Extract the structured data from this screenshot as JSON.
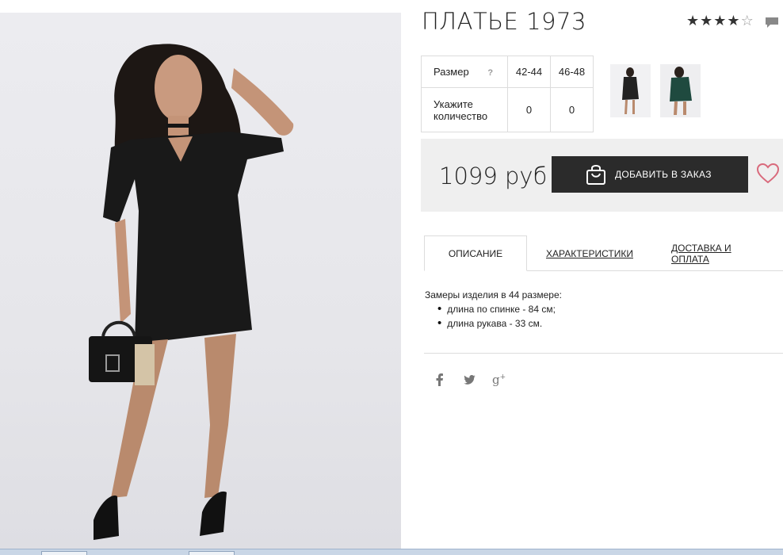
{
  "product": {
    "title": "ПЛАТЬЕ 1973",
    "rating_stars": 4,
    "rating_max": 5
  },
  "icons": {
    "comment": "comment-icon",
    "bag": "shopping-bag-icon",
    "heart": "heart-icon",
    "facebook": "facebook-icon",
    "twitter": "twitter-icon",
    "googleplus": "google-plus-icon"
  },
  "size_table": {
    "size_label": "Размер",
    "help_mark": "?",
    "sizes": [
      "42-44",
      "46-48"
    ],
    "qty_label_1": "Укажите",
    "qty_label_2": "количество",
    "quantities": [
      "0",
      "0"
    ]
  },
  "price": {
    "value": "1099 руб",
    "add_button": "ДОБАВИТЬ В ЗАКАЗ"
  },
  "tabs": [
    {
      "label": "ОПИСАНИЕ",
      "active": true
    },
    {
      "label": "ХАРАКТЕРИСТИКИ",
      "active": false
    },
    {
      "label": "ДОСТАВКА И ОПЛАТА",
      "active": false
    }
  ],
  "description": {
    "intro": "Замеры изделия в 44 размере:",
    "items": [
      "длина по спинке - 84 см;",
      "длина рукава - 33 см."
    ]
  },
  "social": {
    "facebook": "f",
    "twitter": "🐦",
    "googleplus": "g+"
  },
  "colors": {
    "button_bg": "#2b2b2b",
    "price_bg": "#efefef",
    "heart": "#d96a7c",
    "thumb_green": "#1f4a3f"
  }
}
